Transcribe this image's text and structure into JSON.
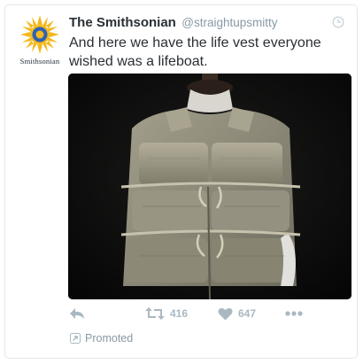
{
  "tweet": {
    "avatar_label": "Smithsonian",
    "display_name": "The Smithsonian",
    "handle": "@straightupsmitty",
    "text": "And here we have the life vest everyone wished was a lifeboat.",
    "media_alt": "Life vest on a mannequin",
    "actions": {
      "retweet_count": "416",
      "like_count": "647"
    },
    "promoted_label": "Promoted"
  },
  "colors": {
    "sun_yellow": "#f3b81d",
    "sun_blue": "#2d62b5",
    "action_gray": "#aab8c2"
  },
  "icons": [
    "clock-icon",
    "reply-icon",
    "retweet-icon",
    "like-icon",
    "more-icon",
    "promoted-icon"
  ]
}
